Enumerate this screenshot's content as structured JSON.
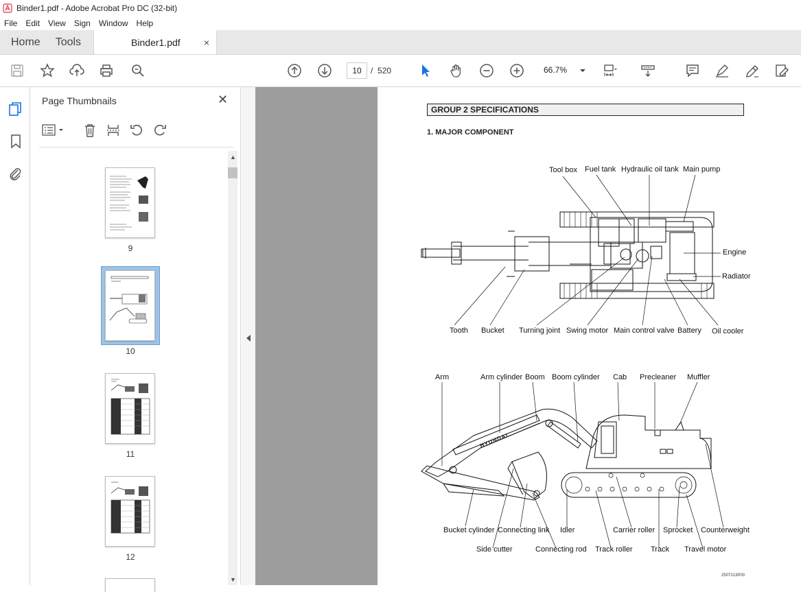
{
  "window": {
    "title": "Binder1.pdf - Adobe Acrobat Pro DC (32-bit)"
  },
  "menu": [
    "File",
    "Edit",
    "View",
    "Sign",
    "Window",
    "Help"
  ],
  "tabs": {
    "home": "Home",
    "tools": "Tools",
    "document": "Binder1.pdf",
    "close": "×"
  },
  "toolbar": {
    "page_current": "10",
    "page_sep": "/",
    "page_total": "520",
    "zoom": "66.7%"
  },
  "colors": {
    "accent": "#1473e6",
    "selection": "#9ec3e6"
  },
  "sidebar": {
    "title": "Page Thumbnails",
    "thumbnails": [
      {
        "label": "9",
        "selected": false
      },
      {
        "label": "10",
        "selected": true
      },
      {
        "label": "11",
        "selected": false
      },
      {
        "label": "12",
        "selected": false
      }
    ]
  },
  "document": {
    "group_title": "GROUP 2  SPECIFICATIONS",
    "subheading": "1. MAJOR COMPONENT",
    "top_view_labels": {
      "tool_box": "Tool box",
      "fuel_tank": "Fuel tank",
      "hydraulic_oil_tank": "Hydraulic oil tank",
      "main_pump": "Main pump",
      "engine": "Engine",
      "radiator": "Radiator",
      "tooth": "Tooth",
      "bucket": "Bucket",
      "turning_joint": "Turning joint",
      "swing_motor": "Swing motor",
      "main_control_valve": "Main control valve",
      "battery": "Battery",
      "oil_cooler": "Oil cooler"
    },
    "side_view_labels": {
      "arm": "Arm",
      "arm_cylinder": "Arm cylinder",
      "boom": "Boom",
      "boom_cylinder": "Boom cylinder",
      "cab": "Cab",
      "precleaner": "Precleaner",
      "muffler": "Muffler",
      "bucket_cylinder": "Bucket cylinder",
      "connecting_link": "Connecting link",
      "idler": "Idler",
      "carrier_roller": "Carrier roller",
      "sprocket": "Sprocket",
      "counterweight": "Counterweight",
      "side_cutter": "Side cutter",
      "connecting_rod": "Connecting rod",
      "track_roller": "Track roller",
      "track": "Track",
      "travel_motor": "Travel motor"
    },
    "brand_text": "HYUNDAI",
    "figure_code": "2507213P00"
  }
}
